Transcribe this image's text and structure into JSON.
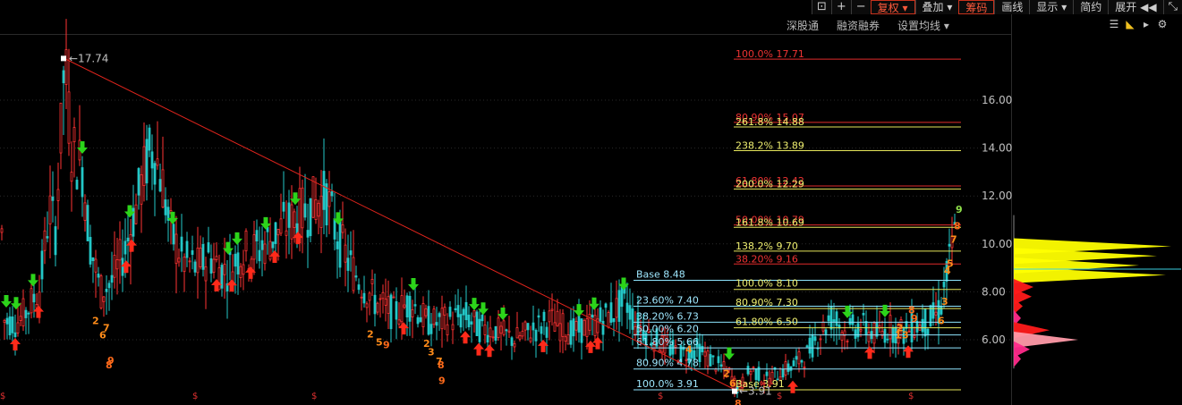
{
  "toolbar": {
    "icons": [
      "window-icon",
      "plus-icon",
      "minus-icon"
    ],
    "buttons": [
      {
        "label": "复权",
        "active": true,
        "dropdown": true
      },
      {
        "label": "叠加",
        "active": false,
        "dropdown": true
      },
      {
        "label": "筹码",
        "active": true,
        "dropdown": false
      },
      {
        "label": "画线",
        "active": false,
        "dropdown": false
      },
      {
        "label": "显示",
        "active": false,
        "dropdown": true
      },
      {
        "label": "简约",
        "active": false,
        "dropdown": false
      },
      {
        "label": "展开",
        "active": false,
        "dropdown": false
      }
    ],
    "expand_arrows": "◀◀"
  },
  "subbar": {
    "items": [
      "深股通",
      "融资融券",
      "设置均线"
    ]
  },
  "sidetools": [
    "toolbar-icon",
    "flag-icon",
    "arrow-icon",
    "settings-icon"
  ],
  "colors": {
    "up": "#ff3333",
    "down": "#23c7c7",
    "trendline": "#e0241c",
    "fib_red": "#e02b2b",
    "fib_yellow": "#e6e65a",
    "fib_cyan": "#8fe6ff",
    "buy_arrow": "#ff2a1a",
    "sell_arrow": "#2cd41a",
    "sequence_orange": "#ff8c1a"
  },
  "chart_data": {
    "type": "candlestick",
    "y_ticks": [
      "16.00",
      "14.00",
      "12.00",
      "10.00",
      "8.00",
      "6.00"
    ],
    "ylim": [
      3.6,
      18.7
    ],
    "high_marker": "17.74",
    "low_marker": "3.91",
    "upper_fib_levels": [
      {
        "label": "100.0%  17.71",
        "value": 17.71,
        "color": "red"
      },
      {
        "label": "80.90%  15.07",
        "value": 15.07,
        "color": "red"
      },
      {
        "label": "261.8%  14.88",
        "value": 14.88,
        "color": "yellow"
      },
      {
        "label": "238.2%  13.89",
        "value": 13.89,
        "color": "yellow"
      },
      {
        "label": "61.80%  12.42",
        "value": 12.42,
        "color": "red"
      },
      {
        "label": "200.0%  12.29",
        "value": 12.29,
        "color": "yellow"
      },
      {
        "label": "50.00%  10.79",
        "value": 10.79,
        "color": "red"
      },
      {
        "label": "161.8%  10.69",
        "value": 10.69,
        "color": "yellow"
      },
      {
        "label": "138.2%  9.70",
        "value": 9.7,
        "color": "yellow"
      },
      {
        "label": "38.20%  9.16",
        "value": 9.16,
        "color": "red"
      }
    ],
    "lower_fib_levels": [
      {
        "label": "Base  8.48",
        "value": 8.48,
        "color": "cyan"
      },
      {
        "label": "100.0%  8.10",
        "value": 8.1,
        "color": "yellow"
      },
      {
        "label": "23.60%  7.40",
        "value": 7.4,
        "color": "cyan"
      },
      {
        "label": "80.90%  7.30",
        "value": 7.3,
        "color": "yellow"
      },
      {
        "label": "38.20%  6.73",
        "value": 6.73,
        "color": "cyan"
      },
      {
        "label": "61.80%  6.50",
        "value": 6.5,
        "color": "yellow"
      },
      {
        "label": "50.00%  6.20",
        "value": 6.2,
        "color": "cyan"
      },
      {
        "label": "61.80%  5.66",
        "value": 5.66,
        "color": "cyan"
      },
      {
        "label": "80.90%  4.78",
        "value": 4.78,
        "color": "cyan"
      },
      {
        "label": "100.0%  3.91",
        "value": 3.91,
        "color": "cyan"
      },
      {
        "label": "Base  3.91",
        "value": 3.91,
        "color": "yellow"
      }
    ],
    "price_path": [
      [
        5,
        6.8
      ],
      [
        18,
        6.7
      ],
      [
        30,
        7.2
      ],
      [
        45,
        8.2
      ],
      [
        55,
        11.5
      ],
      [
        62,
        10.6
      ],
      [
        68,
        14.5
      ],
      [
        72,
        17.74
      ],
      [
        80,
        14.0
      ],
      [
        92,
        13.2
      ],
      [
        100,
        10.2
      ],
      [
        112,
        8.0
      ],
      [
        125,
        8.4
      ],
      [
        140,
        9.8
      ],
      [
        155,
        12.0
      ],
      [
        165,
        13.6
      ],
      [
        172,
        14.0
      ],
      [
        182,
        12.5
      ],
      [
        190,
        10.5
      ],
      [
        205,
        9.3
      ],
      [
        220,
        9.0
      ],
      [
        235,
        9.5
      ],
      [
        250,
        8.8
      ],
      [
        270,
        9.6
      ],
      [
        290,
        9.8
      ],
      [
        305,
        10.3
      ],
      [
        320,
        10.8
      ],
      [
        335,
        11.2
      ],
      [
        350,
        11.6
      ],
      [
        365,
        12.0
      ],
      [
        375,
        10.5
      ],
      [
        390,
        9.2
      ],
      [
        405,
        8.3
      ],
      [
        420,
        7.6
      ],
      [
        440,
        7.1
      ],
      [
        460,
        7.6
      ],
      [
        475,
        6.8
      ],
      [
        490,
        6.7
      ],
      [
        505,
        6.9
      ],
      [
        520,
        7.0
      ],
      [
        535,
        6.5
      ],
      [
        555,
        6.4
      ],
      [
        575,
        6.0
      ],
      [
        595,
        6.4
      ],
      [
        615,
        6.8
      ],
      [
        640,
        6.3
      ],
      [
        660,
        6.6
      ],
      [
        680,
        7.0
      ],
      [
        700,
        7.6
      ],
      [
        710,
        6.7
      ],
      [
        725,
        6.2
      ],
      [
        740,
        5.8
      ],
      [
        760,
        5.4
      ],
      [
        780,
        5.6
      ],
      [
        800,
        5.0
      ],
      [
        815,
        4.6
      ],
      [
        825,
        3.91
      ],
      [
        840,
        4.8
      ],
      [
        855,
        4.3
      ],
      [
        870,
        4.6
      ],
      [
        885,
        4.9
      ],
      [
        900,
        5.3
      ],
      [
        915,
        6.2
      ],
      [
        930,
        7.0
      ],
      [
        945,
        6.3
      ],
      [
        960,
        6.6
      ],
      [
        980,
        6.2
      ],
      [
        995,
        6.5
      ],
      [
        1010,
        6.3
      ],
      [
        1025,
        6.6
      ],
      [
        1040,
        6.8
      ],
      [
        1050,
        7.2
      ],
      [
        1058,
        8.6
      ],
      [
        1063,
        9.6
      ],
      [
        1068,
        10.5
      ]
    ],
    "buy_signals": [
      17,
      43,
      141,
      147,
      242,
      259,
      280,
      307,
      333,
      451,
      520,
      535,
      547,
      607,
      660,
      668,
      886,
      972,
      1015
    ],
    "sell_signals": [
      7,
      18,
      37,
      92,
      145,
      193,
      255,
      265,
      297,
      330,
      378,
      462,
      530,
      540,
      562,
      647,
      664,
      697,
      815,
      947,
      989
    ],
    "sequence_numbers": [
      {
        "x": 103,
        "v": 6.65,
        "t": "2"
      },
      {
        "x": 115,
        "v": 6.35,
        "t": "7"
      },
      {
        "x": 111,
        "v": 6.05,
        "t": "6"
      },
      {
        "x": 120,
        "v": 5.0,
        "t": "9"
      },
      {
        "x": 118,
        "v": 4.8,
        "t": "8"
      },
      {
        "x": 410,
        "v": 6.1,
        "t": "2"
      },
      {
        "x": 420,
        "v": 5.75,
        "t": "5"
      },
      {
        "x": 428,
        "v": 5.65,
        "t": "9"
      },
      {
        "x": 473,
        "v": 5.7,
        "t": "2"
      },
      {
        "x": 478,
        "v": 5.35,
        "t": "3"
      },
      {
        "x": 487,
        "v": 4.95,
        "t": "7"
      },
      {
        "x": 489,
        "v": 4.8,
        "t": "8"
      },
      {
        "x": 490,
        "v": 4.15,
        "t": "9"
      },
      {
        "x": 766,
        "v": 5.45,
        "t": "4"
      },
      {
        "x": 808,
        "v": 4.45,
        "t": "2"
      },
      {
        "x": 815,
        "v": 4.05,
        "t": "6"
      },
      {
        "x": 821,
        "v": 3.2,
        "t": "8"
      },
      {
        "x": 1015,
        "v": 7.1,
        "t": "8"
      },
      {
        "x": 1018,
        "v": 6.75,
        "t": "9"
      },
      {
        "x": 1002,
        "v": 6.35,
        "t": "2"
      },
      {
        "x": 1000,
        "v": 6.05,
        "t": "1"
      },
      {
        "x": 1008,
        "v": 6.05,
        "t": "3"
      },
      {
        "x": 1048,
        "v": 6.65,
        "t": "6"
      },
      {
        "x": 1052,
        "v": 7.45,
        "t": "3"
      },
      {
        "x": 1055,
        "v": 8.75,
        "t": "4"
      },
      {
        "x": 1058,
        "v": 9.05,
        "t": "5"
      },
      {
        "x": 1062,
        "v": 10.05,
        "t": "7"
      },
      {
        "x": 1066,
        "v": 10.6,
        "t": "8"
      },
      {
        "x": 1068,
        "v": 11.3,
        "t": "9"
      }
    ],
    "s_marks": [
      0,
      215,
      348,
      735,
      868,
      1015
    ],
    "volume_profile": [
      {
        "v": 9.9,
        "w": 176,
        "color": "yellow"
      },
      {
        "v": 9.5,
        "w": 160,
        "color": "yellow"
      },
      {
        "v": 9.1,
        "w": 140,
        "color": "yellow"
      },
      {
        "v": 8.7,
        "w": 170,
        "color": "yellow"
      },
      {
        "v": 8.2,
        "w": 22,
        "color": "red"
      },
      {
        "v": 7.8,
        "w": 20,
        "color": "red"
      },
      {
        "v": 7.4,
        "w": 10,
        "color": "red"
      },
      {
        "v": 6.9,
        "w": 8,
        "color": "magenta"
      },
      {
        "v": 6.4,
        "w": 40,
        "color": "red"
      },
      {
        "v": 6.0,
        "w": 72,
        "color": "pink"
      },
      {
        "v": 5.6,
        "w": 18,
        "color": "magenta"
      },
      {
        "v": 5.2,
        "w": 8,
        "color": "magenta"
      }
    ]
  }
}
